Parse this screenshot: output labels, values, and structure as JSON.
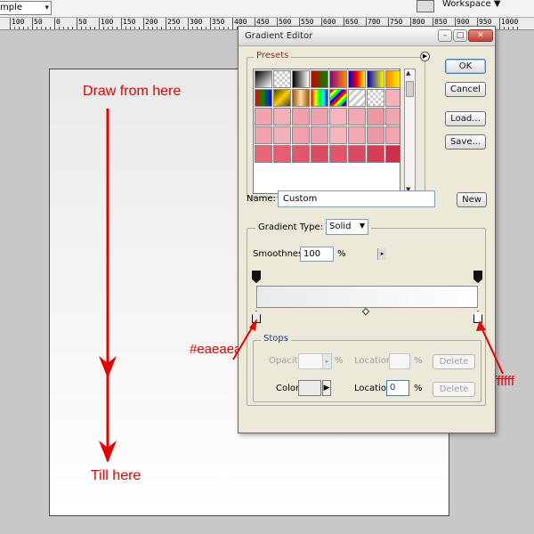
{
  "toolbar": {
    "sample_label": "mple",
    "workspace_label": "Workspace ▼"
  },
  "ruler": {
    "labels": [
      "100",
      "50",
      "0",
      "50",
      "100",
      "150",
      "200",
      "250",
      "300",
      "350",
      "400",
      "450",
      "500",
      "550",
      "600",
      "650",
      "700",
      "750",
      "800",
      "850",
      "900",
      "950",
      "1000"
    ]
  },
  "annotations": {
    "draw_from": "Draw from here",
    "till_here": "Till here",
    "left_color": "#eaeaea",
    "right_color": "#ffffff"
  },
  "dialog": {
    "title": "Gradient Editor",
    "presets_label": "Presets",
    "buttons": {
      "ok": "OK",
      "cancel": "Cancel",
      "load": "Load...",
      "save": "Save...",
      "new": "New"
    },
    "name_label": "Name:",
    "name_value": "Custom",
    "gradient_type_label": "Gradient Type:",
    "gradient_type_value": "Solid",
    "smoothness_label": "Smoothness:",
    "smoothness_value": "100",
    "smoothness_unit": "%",
    "stops": {
      "label": "Stops",
      "opacity_label": "Opacity:",
      "opacity_unit": "%",
      "opacity_location_label": "Location:",
      "opacity_location_unit": "%",
      "delete_label": "Delete",
      "color_label": "Color:",
      "color_location_label": "Location:",
      "color_location_value": "0",
      "color_location_unit": "%"
    },
    "gradient": {
      "start_color": "#eaeaea",
      "end_color": "#ffffff"
    }
  },
  "colors": {
    "annotation_red": "#e80000",
    "dialog_bg": "#ece9d8",
    "workspace_bg": "#c8c8c8"
  }
}
